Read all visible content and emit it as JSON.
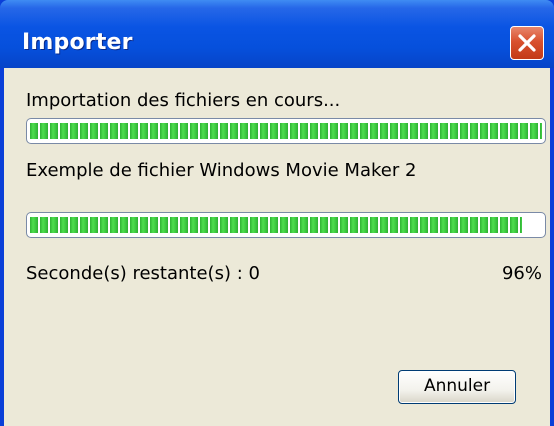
{
  "window": {
    "title": "Importer"
  },
  "status": {
    "heading": "Importation des fichiers en cours...",
    "file_name": "Exemple de fichier Windows Movie Maker 2",
    "remaining_label": "Seconde(s) restante(s) : 0",
    "percent_label": "96%"
  },
  "progress": {
    "overall_fraction": 1.0,
    "file_fraction": 0.96
  },
  "buttons": {
    "cancel_label": "Annuler"
  },
  "icons": {
    "close": "close-icon"
  },
  "colors": {
    "titlebar": "#0a54e3",
    "dialog_background": "#ece9d8",
    "progress_green": "#2fb233",
    "close_red": "#d9512f"
  }
}
